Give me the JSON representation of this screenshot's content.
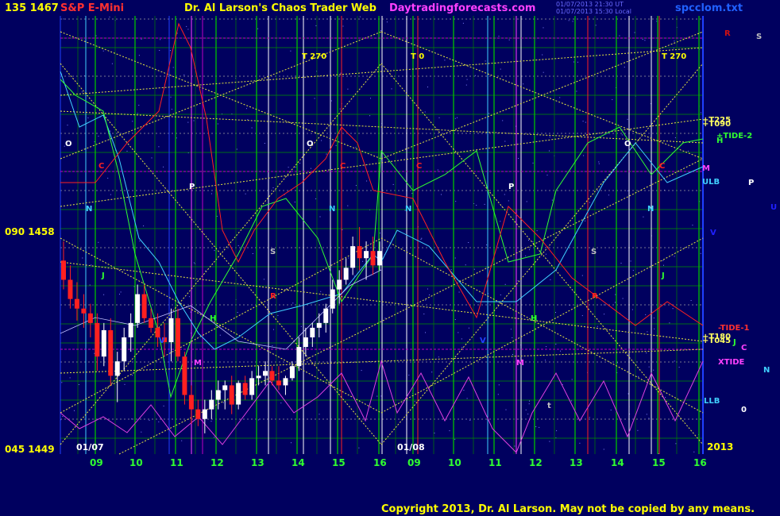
{
  "header": {
    "top_left_scale": "135 1467",
    "market": "S&P E-Mini",
    "site_title": "Dr. Al Larson's Chaos Trader Web",
    "site_url": "Daytradingforecasts.com",
    "stamp_1": "01/07/2013 21:30 UT",
    "stamp_2": "01/07/2013 15:30 Local",
    "file_name": "spcclom.txt"
  },
  "copyright": "Copyright 2013, Dr. Al Larson. May not be copied by any means.",
  "colors": {
    "background": "#00005f",
    "title": "#ffff00",
    "market": "#ff3030",
    "url": "#ff40ff",
    "grid": "#00c000",
    "price_down": "#ff2020",
    "price_up": "#ffffff"
  },
  "chart_data": {
    "type": "candlestick",
    "y_labels": [
      {
        "price": 1467,
        "text": "135 1467"
      },
      {
        "price": 1458,
        "text": "090 1458"
      },
      {
        "price": 1449,
        "text": "045 1449"
      }
    ],
    "ylim": [
      1449,
      1467
    ],
    "x_ticks": [
      "09",
      "10",
      "11",
      "12",
      "13",
      "14",
      "15",
      "16",
      "09",
      "10",
      "11",
      "12",
      "13",
      "14",
      "15",
      "16"
    ],
    "day_labels": [
      "01/07",
      "01/08",
      "2013"
    ],
    "legend_right": [
      {
        "text": "R",
        "color": "#d01010"
      },
      {
        "text": "S",
        "color": "#c0c0c0"
      },
      {
        "text": "+T225",
        "color": "#ffff60"
      },
      {
        "text": "+T090",
        "color": "#ffff60"
      },
      {
        "text": "+TIDE-2",
        "color": "#30ff30"
      },
      {
        "text": "H",
        "color": "#30ff30"
      },
      {
        "text": "M",
        "color": "#ff40ff"
      },
      {
        "text": "ULB",
        "color": "#40d0ff"
      },
      {
        "text": "P",
        "color": "#ffffff"
      },
      {
        "text": "U",
        "color": "#2020ff"
      },
      {
        "text": "V",
        "color": "#2020ff"
      },
      {
        "text": "-TIDE-1",
        "color": "#ff3030"
      },
      {
        "text": "+T180",
        "color": "#ffff60"
      },
      {
        "text": "+T045",
        "color": "#ffff60"
      },
      {
        "text": "J",
        "color": "#30ff30"
      },
      {
        "text": "C",
        "color": "#ff40ff"
      },
      {
        "text": "XTIDE",
        "color": "#ff40ff"
      },
      {
        "text": "N",
        "color": "#40d0ff"
      },
      {
        "text": "LLB",
        "color": "#40d0ff"
      },
      {
        "text": "0",
        "color": "#ffffff"
      }
    ],
    "annotations": [
      {
        "text": "T 270"
      },
      {
        "text": "T 0"
      },
      {
        "text": "T 270"
      },
      {
        "text": "O"
      },
      {
        "text": "O"
      },
      {
        "text": "O"
      },
      {
        "text": "C"
      },
      {
        "text": "C"
      },
      {
        "text": "C"
      },
      {
        "text": "C"
      },
      {
        "text": "P"
      },
      {
        "text": "P"
      },
      {
        "text": "N"
      },
      {
        "text": "N"
      },
      {
        "text": "N"
      },
      {
        "text": "N"
      },
      {
        "text": "S"
      },
      {
        "text": "S"
      },
      {
        "text": "R"
      },
      {
        "text": "R"
      },
      {
        "text": "J"
      },
      {
        "text": "J"
      },
      {
        "text": "H"
      },
      {
        "text": "H"
      },
      {
        "text": "M"
      },
      {
        "text": "M"
      },
      {
        "text": "V"
      },
      {
        "text": "V"
      },
      {
        "text": "t"
      }
    ],
    "price_bars": [
      {
        "o": 1456.8,
        "h": 1457.6,
        "l": 1455.6,
        "c": 1456.0
      },
      {
        "o": 1456.0,
        "h": 1456.6,
        "l": 1454.8,
        "c": 1455.2
      },
      {
        "o": 1455.2,
        "h": 1455.9,
        "l": 1454.3,
        "c": 1454.8
      },
      {
        "o": 1454.8,
        "h": 1455.4,
        "l": 1454.0,
        "c": 1454.6
      },
      {
        "o": 1454.6,
        "h": 1455.0,
        "l": 1453.6,
        "c": 1454.2
      },
      {
        "o": 1454.2,
        "h": 1454.6,
        "l": 1452.2,
        "c": 1452.8
      },
      {
        "o": 1452.8,
        "h": 1454.2,
        "l": 1452.4,
        "c": 1453.9
      },
      {
        "o": 1453.9,
        "h": 1454.4,
        "l": 1451.6,
        "c": 1452.0
      },
      {
        "o": 1452.0,
        "h": 1453.0,
        "l": 1450.9,
        "c": 1452.6
      },
      {
        "o": 1452.6,
        "h": 1454.0,
        "l": 1452.2,
        "c": 1453.6
      },
      {
        "o": 1453.6,
        "h": 1454.6,
        "l": 1453.0,
        "c": 1454.2
      },
      {
        "o": 1454.2,
        "h": 1455.8,
        "l": 1454.0,
        "c": 1455.4
      },
      {
        "o": 1455.4,
        "h": 1455.8,
        "l": 1454.2,
        "c": 1454.4
      },
      {
        "o": 1454.4,
        "h": 1454.8,
        "l": 1453.8,
        "c": 1454.0
      },
      {
        "o": 1454.0,
        "h": 1454.6,
        "l": 1453.2,
        "c": 1453.6
      },
      {
        "o": 1453.6,
        "h": 1454.2,
        "l": 1452.8,
        "c": 1453.4
      },
      {
        "o": 1453.4,
        "h": 1454.8,
        "l": 1452.6,
        "c": 1454.4
      },
      {
        "o": 1454.4,
        "h": 1454.8,
        "l": 1452.6,
        "c": 1452.8
      },
      {
        "o": 1452.8,
        "h": 1453.0,
        "l": 1450.8,
        "c": 1451.2
      },
      {
        "o": 1451.2,
        "h": 1451.6,
        "l": 1450.0,
        "c": 1450.6
      },
      {
        "o": 1450.6,
        "h": 1451.0,
        "l": 1449.9,
        "c": 1450.2
      },
      {
        "o": 1450.2,
        "h": 1451.0,
        "l": 1449.6,
        "c": 1450.6
      },
      {
        "o": 1450.6,
        "h": 1451.4,
        "l": 1450.2,
        "c": 1451.0
      },
      {
        "o": 1451.0,
        "h": 1451.8,
        "l": 1450.6,
        "c": 1451.4
      },
      {
        "o": 1451.4,
        "h": 1451.8,
        "l": 1450.6,
        "c": 1451.6
      },
      {
        "o": 1451.6,
        "h": 1452.0,
        "l": 1450.4,
        "c": 1450.8
      },
      {
        "o": 1450.8,
        "h": 1451.8,
        "l": 1450.6,
        "c": 1451.7
      },
      {
        "o": 1451.7,
        "h": 1452.0,
        "l": 1451.0,
        "c": 1451.2
      },
      {
        "o": 1451.2,
        "h": 1452.2,
        "l": 1451.0,
        "c": 1451.9
      },
      {
        "o": 1451.9,
        "h": 1452.4,
        "l": 1451.6,
        "c": 1452.0
      },
      {
        "o": 1452.0,
        "h": 1452.6,
        "l": 1451.6,
        "c": 1452.2
      },
      {
        "o": 1452.2,
        "h": 1452.4,
        "l": 1451.6,
        "c": 1451.8
      },
      {
        "o": 1451.8,
        "h": 1452.4,
        "l": 1451.4,
        "c": 1451.6
      },
      {
        "o": 1451.6,
        "h": 1452.0,
        "l": 1451.2,
        "c": 1451.9
      },
      {
        "o": 1451.9,
        "h": 1452.6,
        "l": 1451.8,
        "c": 1452.4
      },
      {
        "o": 1452.4,
        "h": 1453.6,
        "l": 1452.2,
        "c": 1453.2
      },
      {
        "o": 1453.2,
        "h": 1454.0,
        "l": 1452.8,
        "c": 1453.6
      },
      {
        "o": 1453.6,
        "h": 1454.2,
        "l": 1453.2,
        "c": 1454.0
      },
      {
        "o": 1454.0,
        "h": 1454.6,
        "l": 1453.6,
        "c": 1454.2
      },
      {
        "o": 1454.2,
        "h": 1455.0,
        "l": 1453.8,
        "c": 1454.8
      },
      {
        "o": 1454.8,
        "h": 1456.0,
        "l": 1454.6,
        "c": 1455.6
      },
      {
        "o": 1455.6,
        "h": 1456.4,
        "l": 1455.0,
        "c": 1456.0
      },
      {
        "o": 1456.0,
        "h": 1456.9,
        "l": 1455.8,
        "c": 1456.5
      },
      {
        "o": 1456.5,
        "h": 1457.8,
        "l": 1456.2,
        "c": 1457.4
      },
      {
        "o": 1457.4,
        "h": 1458.2,
        "l": 1456.4,
        "c": 1456.9
      },
      {
        "o": 1456.9,
        "h": 1457.6,
        "l": 1456.0,
        "c": 1457.2
      },
      {
        "o": 1457.2,
        "h": 1457.8,
        "l": 1456.2,
        "c": 1456.6
      },
      {
        "o": 1456.6,
        "h": 1457.6,
        "l": 1456.4,
        "c": 1457.2
      }
    ]
  }
}
